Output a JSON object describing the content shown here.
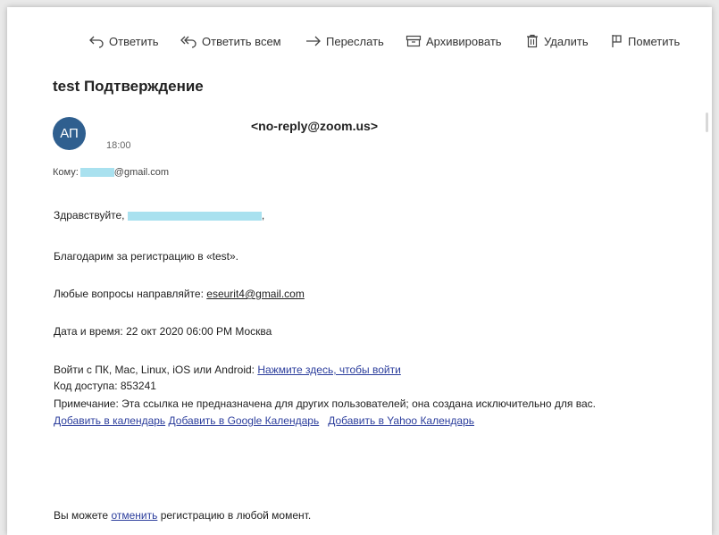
{
  "toolbar": {
    "reply": "Ответить",
    "reply_all": "Ответить всем",
    "forward": "Переслать",
    "archive": "Архивировать",
    "delete": "Удалить",
    "flag": "Пометить"
  },
  "message": {
    "subject": "test Подтверждение",
    "avatar_initials": "АП",
    "avatar_color": "#2f5f8f",
    "sender": "<no-reply@zoom.us>",
    "time": "18:00",
    "to_label": "Кому:",
    "to_domain": "@gmail.com"
  },
  "body": {
    "greeting": "Здравствуйте,",
    "greeting_end": ",",
    "thanks": "Благодарим за регистрацию в «test».",
    "questions_prefix": "Любые вопросы направляйте:",
    "questions_email": "eseurit4@gmail.com",
    "datetime": "Дата и время: 22 окт 2020 06:00 PM Москва",
    "join_prefix": "Войти с ПК, Mac, Linux, iOS или Android:",
    "join_link": "Нажмите здесь, чтобы войти",
    "access_code": "Код доступа: 853241",
    "note": "Примечание: Эта ссылка не предназначена для других пользователей; она создана исключительно для вас.",
    "cal_link_1": "Добавить в календарь",
    "cal_link_2": "Добавить в Google Календарь",
    "cal_link_3": "Добавить в Yahoo Календарь",
    "cancel_prefix": "Вы можете",
    "cancel_link": "отменить",
    "cancel_suffix": "регистрацию в любой момент."
  },
  "colors": {
    "link": "#2b3d9c",
    "redaction": "#a9e1ef"
  }
}
